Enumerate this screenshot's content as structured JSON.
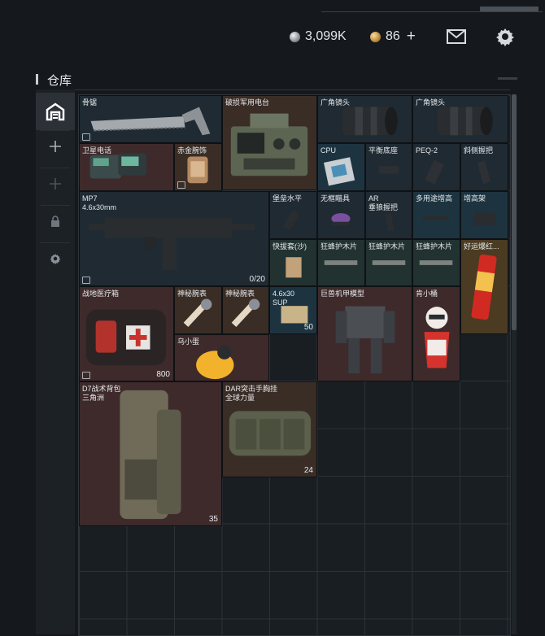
{
  "header": {
    "silver_amount": "3,099K",
    "gold_amount": "86",
    "add_label": "+"
  },
  "warehouse": {
    "title": "仓库"
  },
  "sidebar": {
    "items": [
      {
        "icon": "warehouse-icon",
        "active": true
      },
      {
        "icon": "plus-icon"
      },
      {
        "icon": "plus-icon-disabled"
      },
      {
        "icon": "lock-icon"
      },
      {
        "icon": "gear-icon"
      }
    ]
  },
  "items": {
    "bone_saw": {
      "name": "骨锯"
    },
    "military_radio": {
      "name": "破损军用电台"
    },
    "wide_lens_1": {
      "name": "广角镜头"
    },
    "wide_lens_2": {
      "name": "广角镜头"
    },
    "sat_phone": {
      "name": "卫星电话"
    },
    "gold_relic": {
      "name": "赤金腕饰"
    },
    "cpu": {
      "name": "CPU"
    },
    "balance_base": {
      "name": "平衡底座"
    },
    "peq2": {
      "name": "PEQ-2"
    },
    "side_grip": {
      "name": "斜侧握把"
    },
    "mp7": {
      "name": "MP7\n4.6x30mm",
      "count": "0/20"
    },
    "folding_level": {
      "name": "堡垒水平"
    },
    "frameless_scope": {
      "name": "无框瞄具"
    },
    "ar_grip": {
      "name": "AR\n垂狼握把"
    },
    "multi_riser": {
      "name": "多用途增高"
    },
    "riser": {
      "name": "增高架"
    },
    "quick_pull": {
      "name": "快拔套(沙)"
    },
    "wasp_guard_1": {
      "name": "狂蜂护木片"
    },
    "wasp_guard_2": {
      "name": "狂蜂护木片"
    },
    "wasp_guard_3": {
      "name": "狂蜂护木片"
    },
    "lucky_firecracker": {
      "name": "好运爆红..."
    },
    "field_medkit": {
      "name": "战地医疗箱",
      "count": "800"
    },
    "mystery_watch_1": {
      "name": "神秘腕表"
    },
    "mystery_watch_2": {
      "name": "神秘腕表"
    },
    "ammo_46": {
      "name": "4.6x30\nSUP",
      "count": "50"
    },
    "mecha_model": {
      "name": "巨兽机甲模型"
    },
    "kfc_bucket": {
      "name": "肯小桶"
    },
    "crow_egg": {
      "name": "乌小蛋"
    },
    "backpack_d7": {
      "name": "D7战术背包\n三角洲",
      "count": "35"
    },
    "dar_vest": {
      "name": "DAR突击手胸挂\n全球力量",
      "count": "24"
    }
  },
  "colors": {
    "accent": "#ffffff",
    "grid_bg": "#191e23",
    "rarity_red": "#3e2a2b",
    "rarity_blue": "#1d3440",
    "rarity_gold": "#4b3b22"
  }
}
